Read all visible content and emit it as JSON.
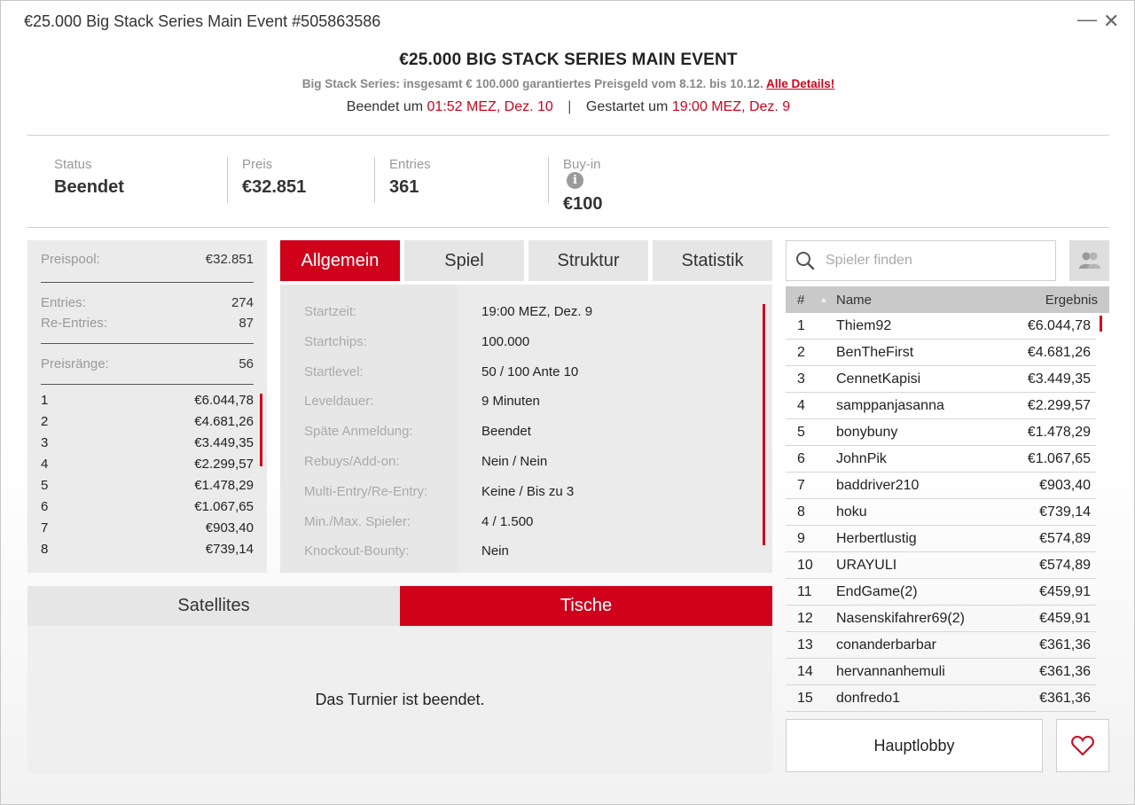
{
  "window": {
    "title": "€25.000 Big Stack Series Main Event #505863586",
    "minimize_glyph": "—",
    "close_glyph": "✕"
  },
  "header": {
    "title": "€25.000 BIG STACK SERIES MAIN EVENT",
    "subtitle": "Big Stack Series: insgesamt € 100.000 garantiertes Preisgeld vom 8.12. bis 10.12.",
    "details_link": "Alle Details!",
    "ended_label": "Beendet um",
    "ended_value": "01:52 MEZ, Dez. 10",
    "separator": "|",
    "started_label": "Gestartet um",
    "started_value": "19:00 MEZ, Dez. 9"
  },
  "info": {
    "status_label": "Status",
    "status_value": "Beendet",
    "prize_label": "Preis",
    "prize_value": "€32.851",
    "entries_label": "Entries",
    "entries_value": "361",
    "buyin_label": "Buy-in",
    "buyin_value": "€100",
    "info_icon_glyph": "i"
  },
  "prizepanel": {
    "pool_label": "Preispool:",
    "pool_value": "€32.851",
    "entries_label": "Entries:",
    "entries_value": "274",
    "reentries_label": "Re-Entries:",
    "reentries_value": "87",
    "ranks_label": "Preisränge:",
    "ranks_value": "56",
    "prizes": [
      {
        "rank": "1",
        "amount": "€6.044,78"
      },
      {
        "rank": "2",
        "amount": "€4.681,26"
      },
      {
        "rank": "3",
        "amount": "€3.449,35"
      },
      {
        "rank": "4",
        "amount": "€2.299,57"
      },
      {
        "rank": "5",
        "amount": "€1.478,29"
      },
      {
        "rank": "6",
        "amount": "€1.067,65"
      },
      {
        "rank": "7",
        "amount": "€903,40"
      },
      {
        "rank": "8",
        "amount": "€739,14"
      }
    ]
  },
  "tabs": [
    "Allgemein",
    "Spiel",
    "Struktur",
    "Statistik"
  ],
  "general": {
    "rows": [
      {
        "key": "Startzeit:",
        "value": "19:00 MEZ, Dez. 9"
      },
      {
        "key": "Startchips:",
        "value": "100.000"
      },
      {
        "key": "Startlevel:",
        "value": "50 / 100 Ante 10"
      },
      {
        "key": "Leveldauer:",
        "value": "9 Minuten"
      },
      {
        "key": "Späte Anmeldung:",
        "value": "Beendet"
      },
      {
        "key": "Rebuys/Add-on:",
        "value": "Nein / Nein"
      },
      {
        "key": "Multi-Entry/Re-Entry:",
        "value": "Keine / Bis zu 3"
      },
      {
        "key": "Min./Max. Spieler:",
        "value": "4 / 1.500"
      },
      {
        "key": "Knockout-Bounty:",
        "value": "Nein"
      }
    ]
  },
  "bottom": {
    "tab_satellites": "Satellites",
    "tab_tables": "Tische",
    "message": "Das Turnier ist beendet."
  },
  "leaderboard": {
    "search_placeholder": "Spieler finden",
    "col_rank": "#",
    "sort_glyph": "▲",
    "col_name": "Name",
    "col_result": "Ergebnis",
    "rows": [
      {
        "rank": "1",
        "name": "Thiem92",
        "result": "€6.044,78"
      },
      {
        "rank": "2",
        "name": "BenTheFirst",
        "result": "€4.681,26"
      },
      {
        "rank": "3",
        "name": "CennetKapisi",
        "result": "€3.449,35"
      },
      {
        "rank": "4",
        "name": "samppanjasanna",
        "result": "€2.299,57"
      },
      {
        "rank": "5",
        "name": "bonybuny",
        "result": "€1.478,29"
      },
      {
        "rank": "6",
        "name": "JohnPik",
        "result": "€1.067,65"
      },
      {
        "rank": "7",
        "name": "baddriver210",
        "result": "€903,40"
      },
      {
        "rank": "8",
        "name": "hoku",
        "result": "€739,14"
      },
      {
        "rank": "9",
        "name": "Herbertlustig",
        "result": "€574,89"
      },
      {
        "rank": "10",
        "name": "URAYULI",
        "result": "€574,89"
      },
      {
        "rank": "11",
        "name": "EndGame(2)",
        "result": "€459,91"
      },
      {
        "rank": "12",
        "name": "Nasenskifahrer69(2)",
        "result": "€459,91"
      },
      {
        "rank": "13",
        "name": "conanderbarbar",
        "result": "€361,36"
      },
      {
        "rank": "14",
        "name": "hervannanhemuli",
        "result": "€361,36"
      },
      {
        "rank": "15",
        "name": "donfredo1",
        "result": "€361,36"
      }
    ],
    "lobby_button": "Hauptlobby"
  },
  "colors": {
    "accent": "#d0021b",
    "panel": "#ebebeb",
    "header_row": "#c9c9c9"
  }
}
